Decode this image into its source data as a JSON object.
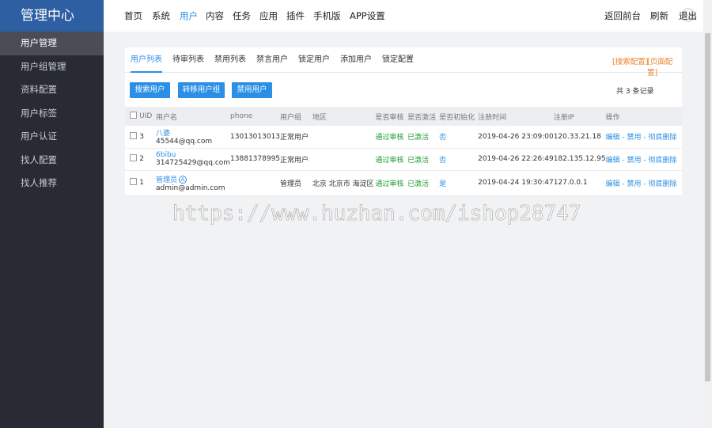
{
  "app": {
    "title": "管理中心"
  },
  "sidebar": {
    "items": [
      {
        "label": "用户管理",
        "active": true
      },
      {
        "label": "用户组管理"
      },
      {
        "label": "资料配置"
      },
      {
        "label": "用户标签"
      },
      {
        "label": "用户认证"
      },
      {
        "label": "找人配置"
      },
      {
        "label": "找人推荐"
      }
    ]
  },
  "topnav": {
    "items": [
      "首页",
      "系统",
      "用户",
      "内容",
      "任务",
      "应用",
      "插件",
      "手机版",
      "APP设置"
    ],
    "active": "用户",
    "right": {
      "back": "返回前台",
      "refresh": "刷新",
      "logout": "退出"
    }
  },
  "tabs": [
    "用户列表",
    "待审列表",
    "禁用列表",
    "禁言用户",
    "锁定用户",
    "添加用户",
    "锁定配置"
  ],
  "config_links": {
    "search": "[搜索配置]",
    "page": "[页面配置]"
  },
  "toolbar": {
    "search": "搜索用户",
    "move": "转移用户组",
    "ban": "禁用用户"
  },
  "count": {
    "prefix": "共",
    "num": "3",
    "suffix": "条记录"
  },
  "table": {
    "headers": {
      "uid": "UID",
      "name": "用户名",
      "phone": "phone",
      "group": "用户组",
      "region": "地区",
      "audit": "是否审核",
      "activated": "是否激活",
      "init": "是否初始化",
      "regtime": "注册时间",
      "ip": "注册IP",
      "ops": "操作"
    },
    "rows": [
      {
        "uid": "3",
        "name": "八婆",
        "email": "45544@qq.com",
        "phone": "13013013013",
        "group": "正常用户",
        "region": "",
        "audit": "通过审核",
        "activated": "已激活",
        "init": "否",
        "regtime": "2019-04-26 23:09:00",
        "ip": "120.33.21.18"
      },
      {
        "uid": "2",
        "name": "6bibu",
        "email": "314725429@qq.com",
        "phone": "13881378995",
        "group": "正常用户",
        "region": "",
        "audit": "通过审核",
        "activated": "已激活",
        "init": "否",
        "regtime": "2019-04-26 22:26:49",
        "ip": "182.135.12.95"
      },
      {
        "uid": "1",
        "name": "管理员",
        "email": "admin@admin.com",
        "phone": "",
        "group": "管理员",
        "region": "北京 北京市 海淀区",
        "audit": "通过审核",
        "activated": "已激活",
        "init": "是",
        "regtime": "2019-04-24 19:30:47",
        "ip": "127.0.0.1"
      }
    ],
    "ops": {
      "edit": "编辑",
      "ban": "禁用",
      "clear": "彻底删除",
      "sep": " - "
    }
  },
  "admin_badge": "A",
  "watermark": "https://www.huzhan.com/ishop28747"
}
